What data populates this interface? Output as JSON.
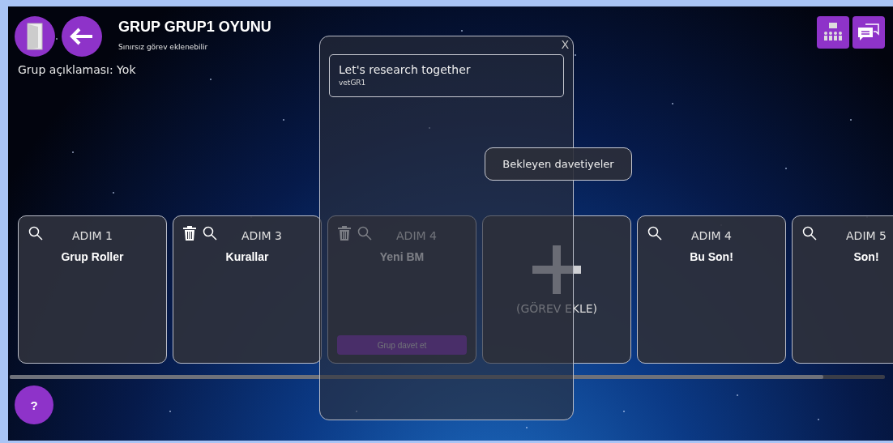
{
  "header": {
    "title": "GRUP GRUP1 OYUNU",
    "subtitle": "Sınırsız görev eklenebilir",
    "description": "Grup açıklaması: Yok"
  },
  "steps": [
    {
      "kind": "step",
      "title": "ADIM 1",
      "name": "Grup Roller",
      "deletable": false
    },
    {
      "kind": "step",
      "title": "ADIM 3",
      "name": "Kurallar",
      "deletable": true
    },
    {
      "kind": "step",
      "title": "ADIM 4",
      "name": "Yeni BM",
      "deletable": true,
      "invite_button": "Grup davet et"
    },
    {
      "kind": "add",
      "label": "(GÖREV EKLE)"
    },
    {
      "kind": "step",
      "title": "ADIM 4",
      "name": "Bu Son!",
      "deletable": false
    },
    {
      "kind": "step",
      "title": "ADIM 5",
      "name": "Son!",
      "deletable": false
    }
  ],
  "help": "?",
  "popup": {
    "close": "X",
    "items": [
      {
        "title": "Let's research together",
        "subtitle": "vetGR1"
      }
    ],
    "pending_button": "Bekleyen davetiyeler"
  }
}
